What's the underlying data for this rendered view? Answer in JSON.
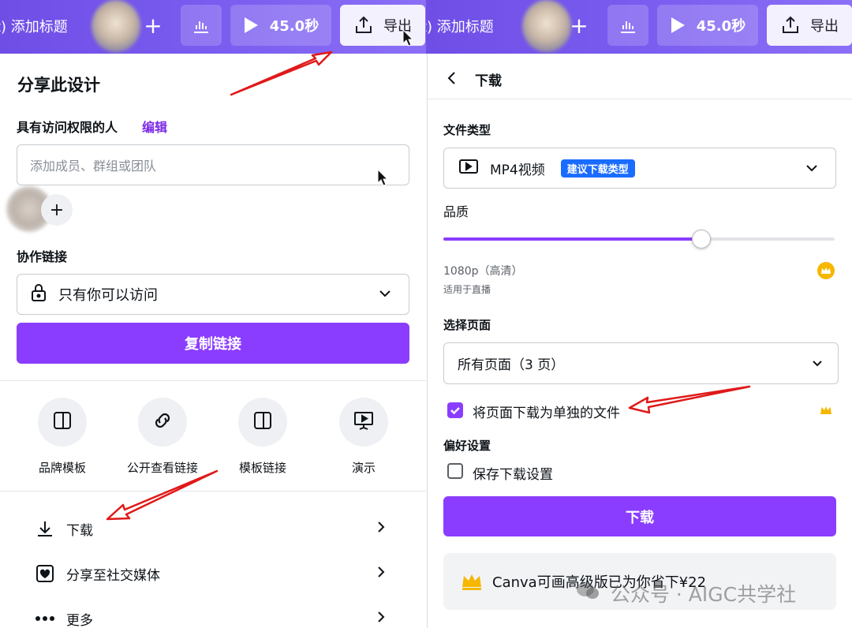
{
  "colors": {
    "accent": "#8b3dff",
    "accent_text": "#7d2ae8",
    "badge_blue": "#1a6cff",
    "topbar": "#7a5cf0",
    "crown": "#f5b700"
  },
  "topbar": {
    "title_fragment": "t) 添加标题",
    "plus_label": "+",
    "timer_label": "45.0秒",
    "export_label": "导出"
  },
  "share_panel": {
    "title": "分享此设计",
    "access_label": "具有访问权限的人",
    "edit_link": "编辑",
    "member_placeholder": "添加成员、群组或团队",
    "add_member": "+",
    "collab_label": "协作链接",
    "access_select": "只有你可以访问",
    "copy_button": "复制链接",
    "options": [
      {
        "label": "品牌模板",
        "icon": "layout-icon"
      },
      {
        "label": "公开查看链接",
        "icon": "link-icon"
      },
      {
        "label": "模板链接",
        "icon": "layout-icon"
      },
      {
        "label": "演示",
        "icon": "present-icon"
      }
    ],
    "menu": [
      {
        "label": "下载",
        "icon": "download-icon"
      },
      {
        "label": "分享至社交媒体",
        "icon": "heart-icon"
      },
      {
        "label": "更多",
        "icon": "more-icon"
      }
    ]
  },
  "download_panel": {
    "title": "下载",
    "file_type_label": "文件类型",
    "file_type_value": "MP4视频",
    "recommend_badge": "建议下载类型",
    "quality_label": "品质",
    "quality_level": 0.66,
    "quality_value": "1080p（高清）",
    "quality_hint": "适用于直播",
    "pages_label": "选择页面",
    "pages_value": "所有页面（3 页）",
    "separate_files_label": "将页面下载为单独的文件",
    "separate_files_checked": true,
    "prefs_label": "偏好设置",
    "save_settings_label": "保存下载设置",
    "save_settings_checked": false,
    "download_button": "下载",
    "promo_text": "Canva可画高级版已为你省下¥22"
  },
  "watermark": "公众号 · AIGC共学社"
}
